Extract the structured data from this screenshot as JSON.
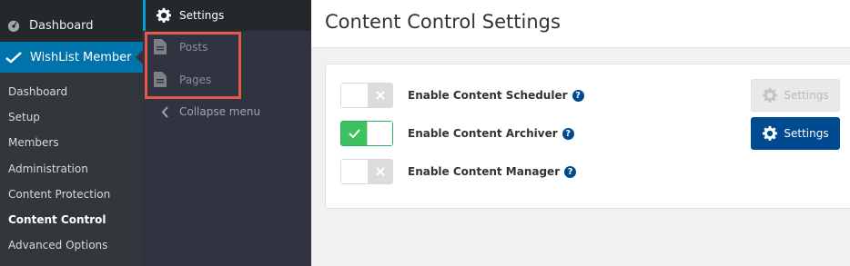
{
  "sidebar": {
    "dashboard_label": "Dashboard",
    "plugin_label": "WishList Member",
    "submenu": [
      {
        "label": "Dashboard",
        "active": false
      },
      {
        "label": "Setup",
        "active": false
      },
      {
        "label": "Members",
        "active": false
      },
      {
        "label": "Administration",
        "active": false
      },
      {
        "label": "Content Protection",
        "active": false
      },
      {
        "label": "Content Control",
        "active": true
      },
      {
        "label": "Advanced Options",
        "active": false
      }
    ]
  },
  "flyout": {
    "settings_label": "Settings",
    "items": [
      {
        "label": "Posts",
        "icon": "document-icon"
      },
      {
        "label": "Pages",
        "icon": "document-icon"
      }
    ],
    "collapse_label": "Collapse menu"
  },
  "main": {
    "title": "Content Control Settings",
    "options": [
      {
        "label": "Enable Content Scheduler",
        "enabled": false,
        "settings_label": "Settings",
        "settings_enabled": false
      },
      {
        "label": "Enable Content Archiver",
        "enabled": true,
        "settings_label": "Settings",
        "settings_enabled": true
      },
      {
        "label": "Enable Content Manager",
        "enabled": false
      }
    ],
    "help_glyph": "?"
  },
  "colors": {
    "admin_sidebar": "#23282d",
    "accent_blue": "#0073aa",
    "button_blue": "#004a8f",
    "toggle_green": "#2ecc71",
    "highlight_red": "#e6574b"
  }
}
